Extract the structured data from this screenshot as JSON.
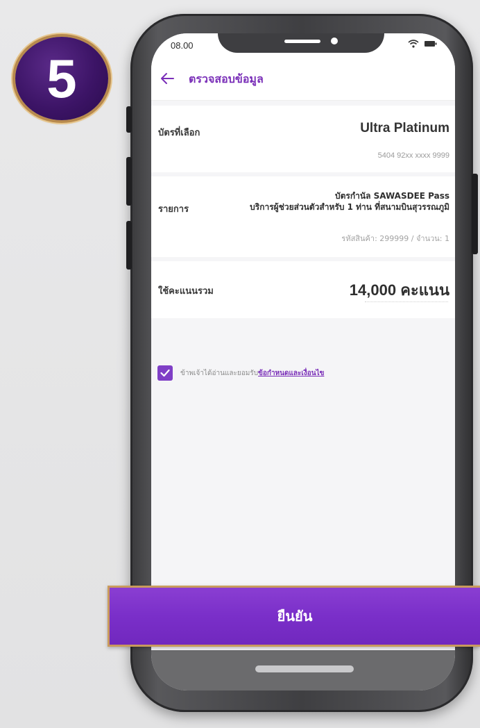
{
  "step_number": "5",
  "status_bar": {
    "time": "08.00"
  },
  "header": {
    "title": "ตรวจสอบข้อมูล"
  },
  "card_section": {
    "label": "บัตรที่เลือก",
    "card_name": "Ultra Platinum",
    "card_number": "5404 92xx xxxx 9999"
  },
  "item_section": {
    "label": "รายการ",
    "item_line1": "บัตรกำนัล SAWASDEE Pass",
    "item_line2": "บริการผู้ช่วยส่วนตัวสำหรับ 1 ท่าน ที่สนามบินสุวรรณภูมิ",
    "item_code": "รหัสสินค้า: 299999 / จำนวน: 1"
  },
  "points_section": {
    "label": "ใช้คะแนนรวม",
    "value": "14,000 คะแนน"
  },
  "terms": {
    "text": "ข้าพเจ้าได้อ่านและยอมรับ",
    "link": "ข้อกำหนดและเงื่อนไข",
    "checked": true
  },
  "confirm_button": {
    "label": "ยืนยัน"
  },
  "colors": {
    "primary": "#7a2fc9",
    "gold_border": "#c99a5d",
    "badge": "#3c1466"
  }
}
